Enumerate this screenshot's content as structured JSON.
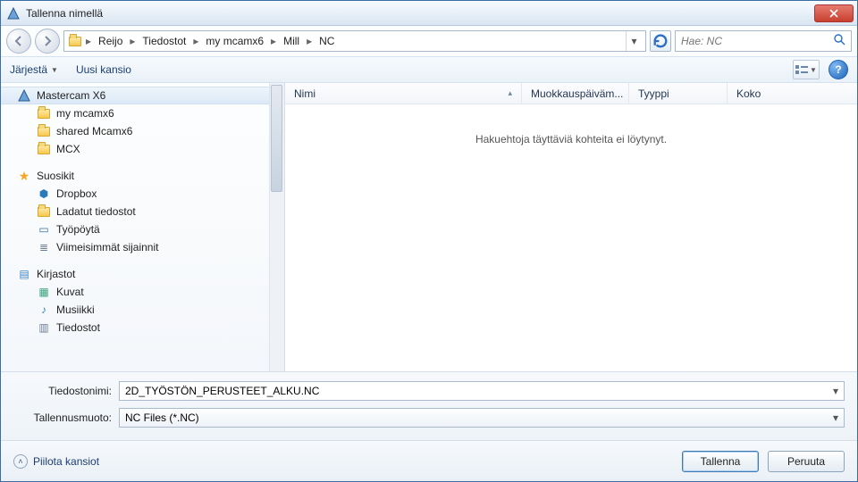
{
  "window": {
    "title": "Tallenna nimellä"
  },
  "breadcrumb": [
    "Reijo",
    "Tiedostot",
    "my mcamx6",
    "Mill",
    "NC"
  ],
  "search": {
    "placeholder": "Hae: NC"
  },
  "toolbar": {
    "organize": "Järjestä",
    "newfolder": "Uusi kansio"
  },
  "columns": {
    "name": "Nimi",
    "modified": "Muokkauspäiväm...",
    "type": "Tyyppi",
    "size": "Koko"
  },
  "empty_message": "Hakuehtoja täyttäviä kohteita ei löytynyt.",
  "tree": {
    "root": "Mastercam X6",
    "root_children": [
      "my mcamx6",
      "shared Mcamx6",
      "MCX"
    ],
    "favorites": "Suosikit",
    "fav_children": [
      "Dropbox",
      "Ladatut tiedostot",
      "Työpöytä",
      "Viimeisimmät sijainnit"
    ],
    "libraries": "Kirjastot",
    "lib_children": [
      "Kuvat",
      "Musiikki",
      "Tiedostot"
    ]
  },
  "fields": {
    "filename_label": "Tiedostonimi:",
    "filename_value": "2D_TYÖSTÖN_PERUSTEET_ALKU.NC",
    "filetype_label": "Tallennusmuoto:",
    "filetype_value": "NC Files (*.NC)"
  },
  "footer": {
    "hide_folders": "Piilota kansiot",
    "save": "Tallenna",
    "cancel": "Peruuta"
  }
}
